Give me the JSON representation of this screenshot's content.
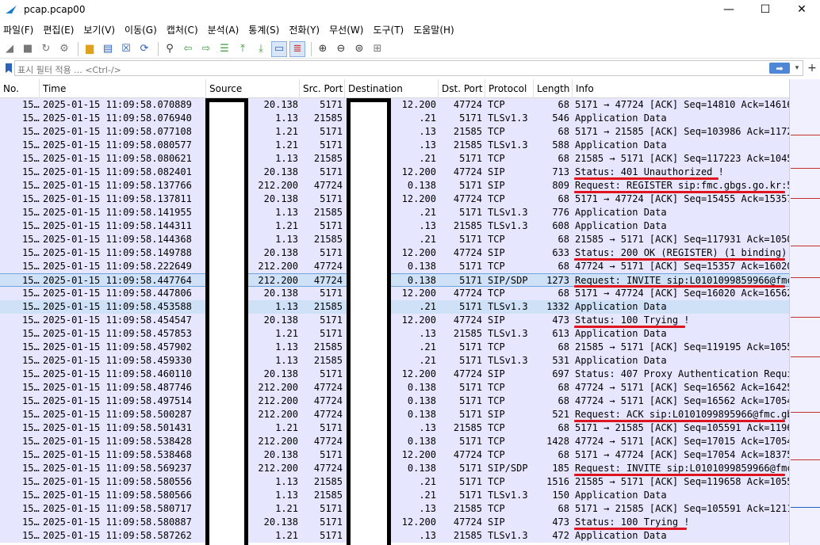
{
  "window": {
    "title": "pcap.pcap00",
    "controls": {
      "minimize": "—",
      "maximize": "☐",
      "close": "✕"
    }
  },
  "menu": [
    "파일(F)",
    "편집(E)",
    "보기(V)",
    "이동(G)",
    "캡처(C)",
    "분석(A)",
    "통계(S)",
    "전화(Y)",
    "무선(W)",
    "도구(T)",
    "도움말(H)"
  ],
  "toolbar": {
    "icons": [
      "shark-fin-start-icon",
      "stop-icon",
      "restart-icon",
      "capture-options-icon",
      "open-file-icon",
      "save-file-icon",
      "close-file-icon",
      "reload-icon",
      "find-packet-icon",
      "go-back-icon",
      "go-forward-icon",
      "go-to-packet-icon",
      "first-packet-icon",
      "last-packet-icon",
      "autoscroll-icon",
      "colorize-icon",
      "zoom-in-icon",
      "zoom-out-icon",
      "zoom-normal-icon",
      "resize-columns-icon"
    ]
  },
  "filter": {
    "placeholder": "표시 필터 적용 ... <Ctrl-/>",
    "apply_label": "➡",
    "dropdown": "▾",
    "add": "+"
  },
  "columns": {
    "no": "No.",
    "time": "Time",
    "source": "Source",
    "src_port": "Src. Port",
    "destination": "Destination",
    "dst_port": "Dst. Port",
    "protocol": "Protocol",
    "length": "Length",
    "info": "Info"
  },
  "packets": [
    {
      "no": "15…",
      "time": "2025-01-15 11:09:58.070889",
      "src": "20.138",
      "sport": "5171",
      "dst": "12.200",
      "dport": "47724",
      "proto": "TCP",
      "len": "68",
      "info": "5171 → 47724 [ACK] Seq=14810 Ack=14616"
    },
    {
      "no": "15…",
      "time": "2025-01-15 11:09:58.076940",
      "src": "1.13",
      "sport": "21585",
      "dst": ".21",
      "dport": "5171",
      "proto": "TLSv1.3",
      "len": "546",
      "info": "Application Data"
    },
    {
      "no": "15…",
      "time": "2025-01-15 11:09:58.077108",
      "src": "1.21",
      "sport": "5171",
      "dst": ".13",
      "dport": "21585",
      "proto": "TCP",
      "len": "68",
      "info": "5171 → 21585 [ACK] Seq=103986 Ack=11722"
    },
    {
      "no": "15…",
      "time": "2025-01-15 11:09:58.080577",
      "src": "1.21",
      "sport": "5171",
      "dst": ".13",
      "dport": "21585",
      "proto": "TLSv1.3",
      "len": "588",
      "info": "Application Data"
    },
    {
      "no": "15…",
      "time": "2025-01-15 11:09:58.080621",
      "src": "1.13",
      "sport": "21585",
      "dst": ".21",
      "dport": "5171",
      "proto": "TCP",
      "len": "68",
      "info": "21585 → 5171 [ACK] Seq=117223 Ack=10456"
    },
    {
      "no": "15…",
      "time": "2025-01-15 11:09:58.082401",
      "src": "20.138",
      "sport": "5171",
      "dst": "12.200",
      "dport": "47724",
      "proto": "SIP",
      "len": "713",
      "info": "Status: 401 Unauthorized !"
    },
    {
      "no": "15…",
      "time": "2025-01-15 11:09:58.137766",
      "src": "212.200",
      "sport": "47724",
      "dst": "0.138",
      "dport": "5171",
      "proto": "SIP",
      "len": "809",
      "info": "Request: REGISTER sip:fmc.gbgs.go.kr:51"
    },
    {
      "no": "15…",
      "time": "2025-01-15 11:09:58.137811",
      "src": "20.138",
      "sport": "5171",
      "dst": "12.200",
      "dport": "47724",
      "proto": "TCP",
      "len": "68",
      "info": "5171 → 47724 [ACK] Seq=15455 Ack=15357"
    },
    {
      "no": "15…",
      "time": "2025-01-15 11:09:58.141955",
      "src": "1.13",
      "sport": "21585",
      "dst": ".21",
      "dport": "5171",
      "proto": "TLSv1.3",
      "len": "776",
      "info": "Application Data"
    },
    {
      "no": "15…",
      "time": "2025-01-15 11:09:58.144311",
      "src": "1.21",
      "sport": "5171",
      "dst": ".13",
      "dport": "21585",
      "proto": "TLSv1.3",
      "len": "608",
      "info": "Application Data"
    },
    {
      "no": "15…",
      "time": "2025-01-15 11:09:58.144368",
      "src": "1.13",
      "sport": "21585",
      "dst": ".21",
      "dport": "5171",
      "proto": "TCP",
      "len": "68",
      "info": "21585 → 5171 [ACK] Seq=117931 Ack=10504"
    },
    {
      "no": "15…",
      "time": "2025-01-15 11:09:58.149788",
      "src": "20.138",
      "sport": "5171",
      "dst": "12.200",
      "dport": "47724",
      "proto": "SIP",
      "len": "633",
      "info": "Status: 200 OK (REGISTER)  (1 binding)"
    },
    {
      "no": "15…",
      "time": "2025-01-15 11:09:58.222649",
      "src": "212.200",
      "sport": "47724",
      "dst": "0.138",
      "dport": "5171",
      "proto": "TCP",
      "len": "68",
      "info": "47724 → 5171 [ACK] Seq=15357 Ack=16020"
    },
    {
      "no": "15…",
      "time": "2025-01-15 11:09:58.447764",
      "src": "212.200",
      "sport": "47724",
      "dst": "0.138",
      "dport": "5171",
      "proto": "SIP/SDP",
      "len": "1273",
      "info": "Request: INVITE sip:L0101099859966@fmc"
    },
    {
      "no": "15…",
      "time": "2025-01-15 11:09:58.447806",
      "src": "20.138",
      "sport": "5171",
      "dst": "12.200",
      "dport": "47724",
      "proto": "TCP",
      "len": "68",
      "info": "5171 → 47724 [ACK] Seq=16020 Ack=16562"
    },
    {
      "no": "15…",
      "time": "2025-01-15 11:09:58.453588",
      "src": "1.13",
      "sport": "21585",
      "dst": ".21",
      "dport": "5171",
      "proto": "TLSv1.3",
      "len": "1332",
      "info": "Application Data"
    },
    {
      "no": "15…",
      "time": "2025-01-15 11:09:58.454547",
      "src": "20.138",
      "sport": "5171",
      "dst": "12.200",
      "dport": "47724",
      "proto": "SIP",
      "len": "473",
      "info": "Status: 100 Trying !"
    },
    {
      "no": "15…",
      "time": "2025-01-15 11:09:58.457853",
      "src": "1.21",
      "sport": "5171",
      "dst": ".13",
      "dport": "21585",
      "proto": "TLSv1.3",
      "len": "613",
      "info": "Application Data"
    },
    {
      "no": "15…",
      "time": "2025-01-15 11:09:58.457902",
      "src": "1.13",
      "sport": "21585",
      "dst": ".21",
      "dport": "5171",
      "proto": "TCP",
      "len": "68",
      "info": "21585 → 5171 [ACK] Seq=119195 Ack=10559"
    },
    {
      "no": "15…",
      "time": "2025-01-15 11:09:58.459330",
      "src": "1.13",
      "sport": "21585",
      "dst": ".21",
      "dport": "5171",
      "proto": "TLSv1.3",
      "len": "531",
      "info": "Application Data"
    },
    {
      "no": "15…",
      "time": "2025-01-15 11:09:58.460110",
      "src": "20.138",
      "sport": "5171",
      "dst": "12.200",
      "dport": "47724",
      "proto": "SIP",
      "len": "697",
      "info": "Status: 407 Proxy Authentication Requir"
    },
    {
      "no": "15…",
      "time": "2025-01-15 11:09:58.487746",
      "src": "212.200",
      "sport": "47724",
      "dst": "0.138",
      "dport": "5171",
      "proto": "TCP",
      "len": "68",
      "info": "47724 → 5171 [ACK] Seq=16562 Ack=16425"
    },
    {
      "no": "15…",
      "time": "2025-01-15 11:09:58.497514",
      "src": "212.200",
      "sport": "47724",
      "dst": "0.138",
      "dport": "5171",
      "proto": "TCP",
      "len": "68",
      "info": "47724 → 5171 [ACK] Seq=16562 Ack=17054"
    },
    {
      "no": "15…",
      "time": "2025-01-15 11:09:58.500287",
      "src": "212.200",
      "sport": "47724",
      "dst": "0.138",
      "dport": "5171",
      "proto": "SIP",
      "len": "521",
      "info": "Request: ACK sip:L0101099895966@fmc.gbg"
    },
    {
      "no": "15…",
      "time": "2025-01-15 11:09:58.501431",
      "src": "1.21",
      "sport": "5171",
      "dst": ".13",
      "dport": "21585",
      "proto": "TCP",
      "len": "68",
      "info": "5171 → 21585 [ACK] Seq=105591 Ack=11965"
    },
    {
      "no": "15…",
      "time": "2025-01-15 11:09:58.538428",
      "src": "212.200",
      "sport": "47724",
      "dst": "0.138",
      "dport": "5171",
      "proto": "TCP",
      "len": "1428",
      "info": "47724 → 5171 [ACK] Seq=17015 Ack=17054"
    },
    {
      "no": "15…",
      "time": "2025-01-15 11:09:58.538468",
      "src": "20.138",
      "sport": "5171",
      "dst": "12.200",
      "dport": "47724",
      "proto": "TCP",
      "len": "68",
      "info": "5171 → 47724 [ACK] Seq=17054 Ack=18375"
    },
    {
      "no": "15…",
      "time": "2025-01-15 11:09:58.569237",
      "src": "212.200",
      "sport": "47724",
      "dst": "0.138",
      "dport": "5171",
      "proto": "SIP/SDP",
      "len": "185",
      "info": "Request: INVITE sip:L0101099859966@fmc."
    },
    {
      "no": "15…",
      "time": "2025-01-15 11:09:58.580556",
      "src": "1.13",
      "sport": "21585",
      "dst": ".21",
      "dport": "5171",
      "proto": "TCP",
      "len": "1516",
      "info": "21585 → 5171 [ACK] Seq=119658 Ack=10559"
    },
    {
      "no": "15…",
      "time": "2025-01-15 11:09:58.580566",
      "src": "1.13",
      "sport": "21585",
      "dst": ".21",
      "dport": "5171",
      "proto": "TLSv1.3",
      "len": "150",
      "info": "Application Data"
    },
    {
      "no": "15…",
      "time": "2025-01-15 11:09:58.580717",
      "src": "1.21",
      "sport": "5171",
      "dst": ".13",
      "dport": "21585",
      "proto": "TCP",
      "len": "68",
      "info": "5171 → 21585 [ACK] Seq=105591 Ack=12118"
    },
    {
      "no": "15…",
      "time": "2025-01-15 11:09:58.580887",
      "src": "20.138",
      "sport": "5171",
      "dst": "12.200",
      "dport": "47724",
      "proto": "SIP",
      "len": "473",
      "info": "Status: 100 Trying !"
    },
    {
      "no": "15…",
      "time": "2025-01-15 11:09:58.587262",
      "src": "1.21",
      "sport": "5171",
      "dst": ".13",
      "dport": "21585",
      "proto": "TLSv1.3",
      "len": "472",
      "info": "Application Data"
    }
  ],
  "selected_row_index": 13,
  "highlighted_row_index": 15,
  "underlined_rows": [
    5,
    6,
    11,
    13,
    16,
    23,
    27,
    31
  ],
  "colors": {
    "row_bg": "#e7e6ff",
    "selected_bg": "#cfe1f7",
    "annotation_red": "#e0141e",
    "redaction": "#000000"
  }
}
